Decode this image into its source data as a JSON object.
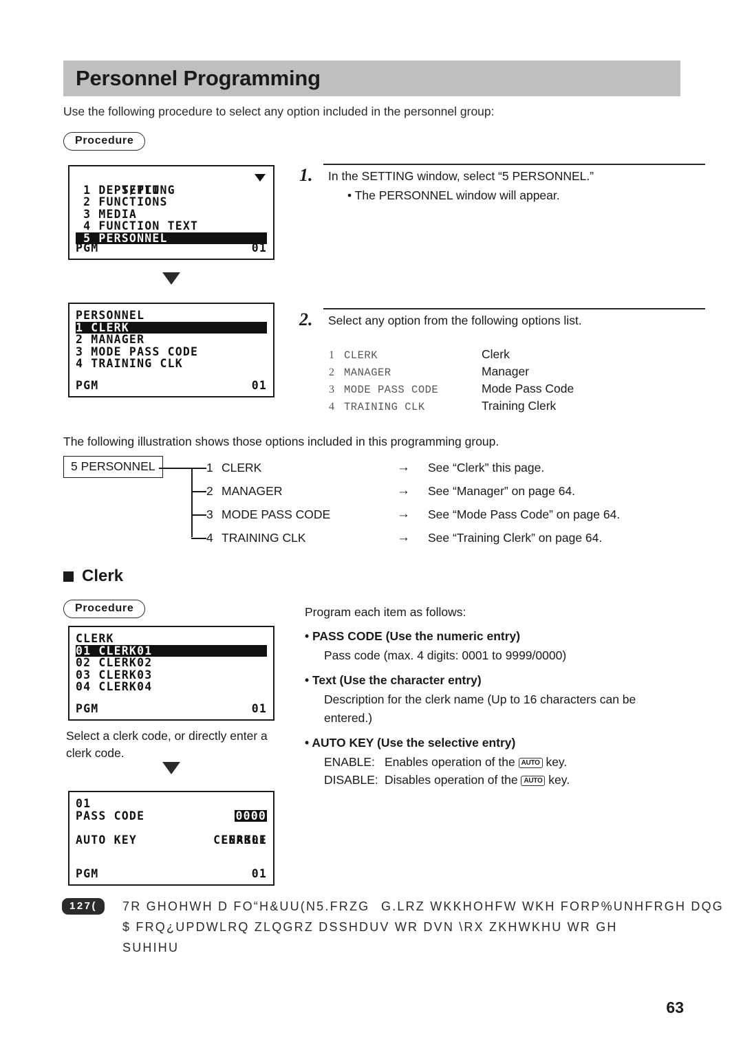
{
  "header": {
    "title": "Personnel Programming",
    "banner_color": "#bfbfbf"
  },
  "intro": "Use the following procedure to select any option included in the personnel group:",
  "procedure_label": "Procedure",
  "screens": {
    "setting": {
      "title": "SETTING",
      "rows": [
        " 1 DEPT/PLU",
        " 2 FUNCTIONS",
        " 3 MEDIA",
        " 4 FUNCTION TEXT"
      ],
      "selected": " 5 PERSONNEL",
      "mode": "PGM",
      "clerk": "01",
      "scroll_icon": "caret-down-icon"
    },
    "personnel": {
      "title": "PERSONNEL",
      "selected": "1 CLERK",
      "rows": [
        "2 MANAGER",
        "3 MODE PASS CODE",
        "4 TRAINING CLK"
      ],
      "mode": "PGM",
      "clerk": "01"
    },
    "clerk_list": {
      "title": "CLERK",
      "selected": "01 CLERK01",
      "rows": [
        "02 CLERK02",
        "03 CLERK03",
        "04 CLERK04"
      ],
      "mode": "PGM",
      "clerk": "01"
    },
    "clerk_detail": {
      "title": "01",
      "pass_code_label": "PASS CODE",
      "pass_code_value": "0000",
      "name_value": "CLERK01",
      "auto_key_label": "AUTO KEY",
      "auto_key_value": "ENABLE",
      "mode": "PGM",
      "clerk": "01"
    }
  },
  "steps": [
    {
      "number": "1.",
      "text": "In the SETTING window, select “5 PERSONNEL.”",
      "sub": "• The PERSONNEL window will appear."
    },
    {
      "number": "2.",
      "text": "Select any option from the following options list."
    }
  ],
  "options": [
    {
      "num": "1",
      "code": "CLERK",
      "label": "Clerk"
    },
    {
      "num": "2",
      "code": "MANAGER",
      "label": "Manager"
    },
    {
      "num": "3",
      "code": "MODE PASS CODE",
      "label": "Mode Pass Code"
    },
    {
      "num": "4",
      "code": "TRAINING CLK",
      "label": "Training Clerk"
    }
  ],
  "tree": {
    "intro": "The following illustration shows those options included in this programming group.",
    "root": "5 PERSONNEL",
    "arrow_glyph": "→",
    "items": [
      {
        "num": "1",
        "name": "CLERK",
        "see": "See “Clerk” this page."
      },
      {
        "num": "2",
        "name": "MANAGER",
        "see": "See “Manager” on page 64."
      },
      {
        "num": "3",
        "name": "MODE PASS CODE",
        "see": "See “Mode Pass Code” on page 64."
      },
      {
        "num": "4",
        "name": "TRAINING CLK",
        "see": "See “Training Clerk” on page 64."
      }
    ]
  },
  "clerk_section": {
    "heading": "Clerk",
    "lead": "Program each item as follows:",
    "items": [
      {
        "head": "• PASS CODE (Use the numeric entry)",
        "body": "Pass code (max. 4 digits: 0001 to 9999/0000)"
      },
      {
        "head": "• Text (Use the character entry)",
        "body": "Description for the clerk name (Up to 16 characters can be entered.)"
      }
    ],
    "auto_key": {
      "head": "• AUTO KEY (Use the selective entry)",
      "enable_label": "ENABLE:",
      "enable_text_before": "Enables operation of the",
      "enable_text_after": "key.",
      "disable_label": "DISABLE:",
      "disable_text_before": "Disables operation of the",
      "disable_text_after": "key.",
      "keycap": "AUTO"
    },
    "select_note": "Select a clerk code, or directly enter a clerk code."
  },
  "note": {
    "badge": "127(",
    "line1": "7R GHOHWH D FO“H&UU(N5.FRZGG.LRZ WKKHOHFW WKH FORP%UNHFRGH DQG",
    "line2": "$ FRQ¿UPDWLRQ ZLQGRZ DSSHDUV WR DVN \\RX ZKHWKHU WR GH",
    "line3": "SUHIHU"
  },
  "page_number": "63"
}
